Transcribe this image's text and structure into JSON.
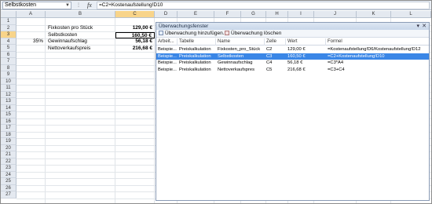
{
  "formula_bar": {
    "name_box": "Selbstkosten",
    "fx_label": "fx",
    "formula": "=C2+Kostenaufstellung!D10"
  },
  "columns": [
    "A",
    "B",
    "C",
    "D",
    "E",
    "F",
    "G",
    "H",
    "I",
    "J",
    "K",
    "L"
  ],
  "rows": [
    "1",
    "2",
    "3",
    "4",
    "5",
    "6",
    "7",
    "8",
    "9",
    "10",
    "11",
    "12",
    "13",
    "14",
    "15",
    "16",
    "17",
    "18",
    "19",
    "20",
    "21",
    "22",
    "23",
    "24",
    "25",
    "26",
    "27"
  ],
  "cells": {
    "b2": "Fixkosten pro Stück",
    "c2": "129,00 €",
    "b3": "Selbstkosten",
    "c3": "160,50 €",
    "a4": "35%",
    "b4": "Gewinnaufschlag",
    "c4": "56,18 €",
    "b5": "Nettoverkaufspreis",
    "c5": "216,68 €"
  },
  "watch_window": {
    "title": "Überwachungsfenster",
    "controls": {
      "dropdown": "▾",
      "close": "✕"
    },
    "add_label": "Überwachung hinzufügen...",
    "delete_label": "Überwachung löschen",
    "headers": [
      "Arbeit...",
      "Tabelle",
      "Name",
      "Zelle",
      "Wert",
      "Formel"
    ],
    "rows": [
      [
        "Beispie...",
        "Preiskalkulation",
        "Fixkosten_pro_Stück",
        "C2",
        "129,00 €",
        "=Kostenaufstellung!D6/Kostenaufstellung!D12"
      ],
      [
        "Beispie...",
        "Preiskalkulation",
        "Selbstkosten",
        "C3",
        "160,50 €",
        "=C2+Kostenaufstellung!D10"
      ],
      [
        "Beispie...",
        "Preiskalkulation",
        "Gewinnaufschlag",
        "C4",
        "56,18 €",
        "=C3*A4"
      ],
      [
        "Beispie...",
        "Preiskalkulation",
        "Nettoverkaufspres",
        "C5",
        "216,68 €",
        "=C3+C4"
      ]
    ],
    "selected_row": 1
  }
}
